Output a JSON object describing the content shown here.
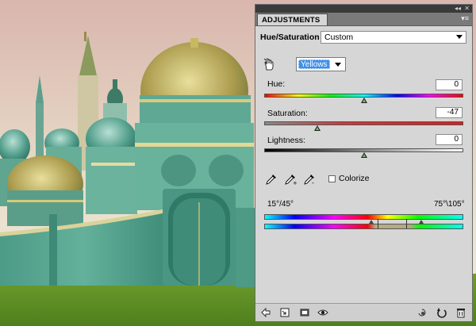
{
  "panel": {
    "tab_label": "ADJUSTMENTS",
    "collapse_glyph": "◂◂",
    "close_glyph": "✕",
    "menu_glyph": "▾≡",
    "adjustment_name": "Hue/Saturation",
    "preset_value": "Custom",
    "channel_value": "Yellows"
  },
  "controls": {
    "hue": {
      "label": "Hue:",
      "value": "0",
      "fraction": 0.5
    },
    "saturation": {
      "label": "Saturation:",
      "value": "-47",
      "fraction": 0.265
    },
    "lightness": {
      "label": "Lightness:",
      "value": "0",
      "fraction": 0.5
    }
  },
  "colorize": {
    "label": "Colorize",
    "checked": false
  },
  "range": {
    "left_label": "15°/45°",
    "right_label": "75°\\105°"
  },
  "icons": {
    "hand": "on-image-adjust-icon",
    "eyedropper": "eyedropper-icon",
    "eyedropper_plus": "eyedropper-add-icon",
    "eyedropper_minus": "eyedropper-subtract-icon",
    "footer": [
      "return-arrow-icon",
      "clip-layer-icon",
      "layer-visibility-icon",
      "eye-icon",
      "view-previous-icon",
      "reset-icon",
      "trash-icon"
    ]
  }
}
